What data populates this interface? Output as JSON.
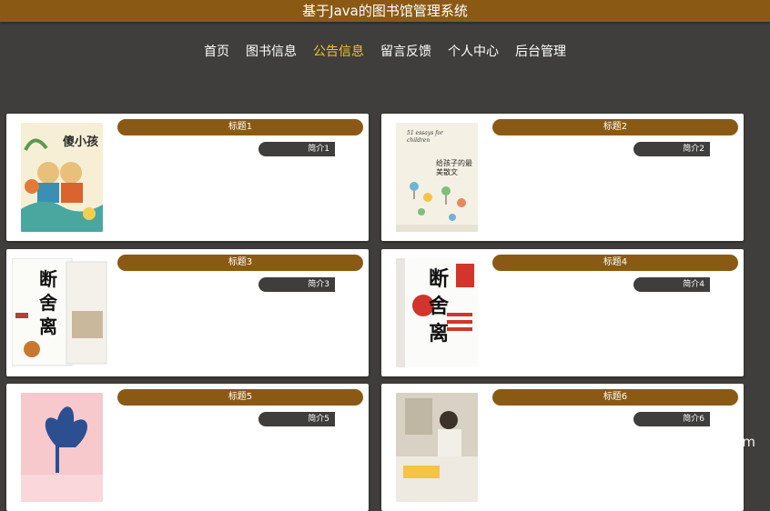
{
  "header": {
    "title": "基于Java的图书馆管理系统"
  },
  "nav": [
    {
      "label": "首页",
      "active": false
    },
    {
      "label": "图书信息",
      "active": false
    },
    {
      "label": "公告信息",
      "active": true
    },
    {
      "label": "留言反馈",
      "active": false
    },
    {
      "label": "个人中心",
      "active": false
    },
    {
      "label": "后台管理",
      "active": false
    }
  ],
  "cards": [
    {
      "title": "标题1",
      "intro": "简介1",
      "cover_title": "傻小孩"
    },
    {
      "title": "标题2",
      "intro": "简介2",
      "cover_title": "给孩子的最美散文",
      "cover_subtitle": "51 essays for children"
    },
    {
      "title": "标题3",
      "intro": "简介3",
      "cover_title": "断舍离"
    },
    {
      "title": "标题4",
      "intro": "简介4",
      "cover_title": "断舍离"
    },
    {
      "title": "标题5",
      "intro": "简介5",
      "cover_title": ""
    },
    {
      "title": "标题6",
      "intro": "简介6",
      "cover_title": ""
    }
  ],
  "watermark": "CSDN @ZhangBlossom",
  "colors": {
    "brand": "#8a5a14",
    "active": "#f3c02e",
    "background": "#3f3e3c"
  }
}
